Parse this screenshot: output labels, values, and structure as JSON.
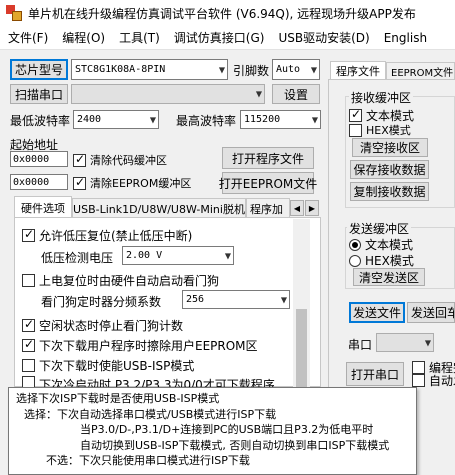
{
  "window": {
    "title": "单片机在线升级编程仿真调试平台软件 (V6.94Q), 远程现场升级APP发布"
  },
  "menu": [
    "文件(F)",
    "编程(O)",
    "工具(T)",
    "调试仿真接口(G)",
    "USB驱动安装(D)",
    "English"
  ],
  "chip": {
    "button": "芯片型号",
    "value": "STC8G1K08A-8PIN",
    "pins_label": "引脚数",
    "pins_value": "Auto"
  },
  "port": {
    "scan_button": "扫描串口",
    "settings_button": "设置"
  },
  "baud": {
    "min_label": "最低波特率",
    "min_value": "2400",
    "max_label": "最高波特率",
    "max_value": "115200"
  },
  "address": {
    "title": "起始地址",
    "code_addr": "0x0000",
    "clear_code_label": "清除代码缓冲区",
    "open_program_button": "打开程序文件",
    "eeprom_addr": "0x0000",
    "clear_eeprom_label": "清除EEPROM缓冲区",
    "open_eeprom_button": "打开EEPROM文件"
  },
  "tabs": [
    "硬件选项",
    "USB-Link1D/U8W/U8W-Mini脱机",
    "程序加"
  ],
  "options": {
    "allow_low_voltage_reset": "允许低压复位(禁止低压中断)",
    "low_voltage_label": "低压检测电压",
    "low_voltage_value": "2.00 V",
    "power_on_watchdog": "上电复位时由硬件自动启动看门狗",
    "watchdog_prescaler_label": "看门狗定时器分频系数",
    "watchdog_prescaler_value": "256",
    "idle_stop_watchdog": "空闲状态时停止看门狗计数",
    "erase_eeprom": "下次下载用户程序时擦除用户EEPROM区",
    "usb_isp_next": "下次下载时使能USB-ISP模式",
    "partial_row": "下次冷启动时,P3.2/P3.3为0/0才可下载程序"
  },
  "right_tabs": [
    "程序文件",
    "EEPROM文件"
  ],
  "receive": {
    "title": "接收缓冲区",
    "text_mode": "文本模式",
    "hex_mode": "HEX模式",
    "clear_button": "清空接收区",
    "save_button": "保存接收数据",
    "copy_button": "复制接收数据"
  },
  "send": {
    "title": "发送缓冲区",
    "text_mode": "文本模式",
    "hex_mode": "HEX模式",
    "clear_button": "清空发送区",
    "send_file_button": "发送文件",
    "send_return_button": "发送回车"
  },
  "serial": {
    "port_label": "串口",
    "open_button": "打开串口",
    "programmer_label": "编程完",
    "auto_label": "自动发"
  },
  "tooltip": {
    "line1": "选择下次ISP下载时是否使用USB-ISP模式",
    "line2": "选择：下次自动选择串口模式/USB模式进行ISP下载",
    "line3": "当P3.0/D-,P3.1/D+连接到PC的USB端口且P3.2为低电平时",
    "line4": "自动切换到USB-ISP下载模式, 否则自动切换到串口ISP下载模式",
    "line5": "不选：下次只能使用串口模式进行ISP下载"
  },
  "partial_left": "选"
}
